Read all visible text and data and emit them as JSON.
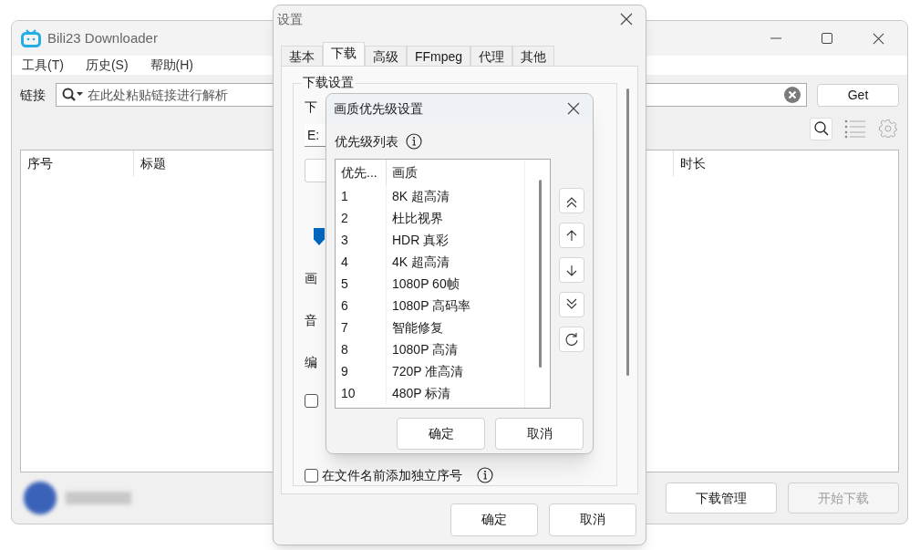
{
  "main_window": {
    "title": "Bili23 Downloader",
    "menu": [
      "工具(T)",
      "历史(S)",
      "帮助(H)"
    ],
    "link_label": "链接",
    "search": {
      "placeholder": "在此处粘贴链接进行解析"
    },
    "get_button": "Get",
    "table": {
      "columns": [
        "序号",
        "标题",
        "时长"
      ]
    },
    "buttons": [
      {
        "label": "下载管理",
        "disabled": false
      },
      {
        "label": "开始下载",
        "disabled": true
      }
    ]
  },
  "settings_dialog": {
    "title": "设置",
    "tabs": [
      {
        "label": "基本",
        "selected": false
      },
      {
        "label": "下载",
        "selected": true
      },
      {
        "label": "高级",
        "selected": false
      },
      {
        "label": "FFmpeg",
        "selected": false
      },
      {
        "label": "代理",
        "selected": false
      },
      {
        "label": "其他",
        "selected": false
      }
    ],
    "group_title": "下载设置",
    "partial": {
      "path_label": "下",
      "path_value": "E:",
      "quality_label": "画",
      "audio_label": "音",
      "codec_label": "编",
      "checkbox_checked": false
    },
    "checkboxes": [
      {
        "label": "在文件名前添加独立序号",
        "checked": false
      }
    ],
    "buttons": [
      "确定",
      "取消"
    ]
  },
  "priority_dialog": {
    "title": "画质优先级设置",
    "list_label": "优先级列表",
    "columns": [
      "优先...",
      "画质"
    ],
    "rows": [
      {
        "priority": "1",
        "quality": "8K 超高清"
      },
      {
        "priority": "2",
        "quality": "杜比视界"
      },
      {
        "priority": "3",
        "quality": "HDR 真彩"
      },
      {
        "priority": "4",
        "quality": "4K 超高清"
      },
      {
        "priority": "5",
        "quality": "1080P 60帧"
      },
      {
        "priority": "6",
        "quality": "1080P 高码率"
      },
      {
        "priority": "7",
        "quality": "智能修复"
      },
      {
        "priority": "8",
        "quality": "1080P 高清"
      },
      {
        "priority": "9",
        "quality": "720P 准高清"
      },
      {
        "priority": "10",
        "quality": "480P 标清"
      }
    ],
    "buttons": [
      "确定",
      "取消"
    ]
  }
}
